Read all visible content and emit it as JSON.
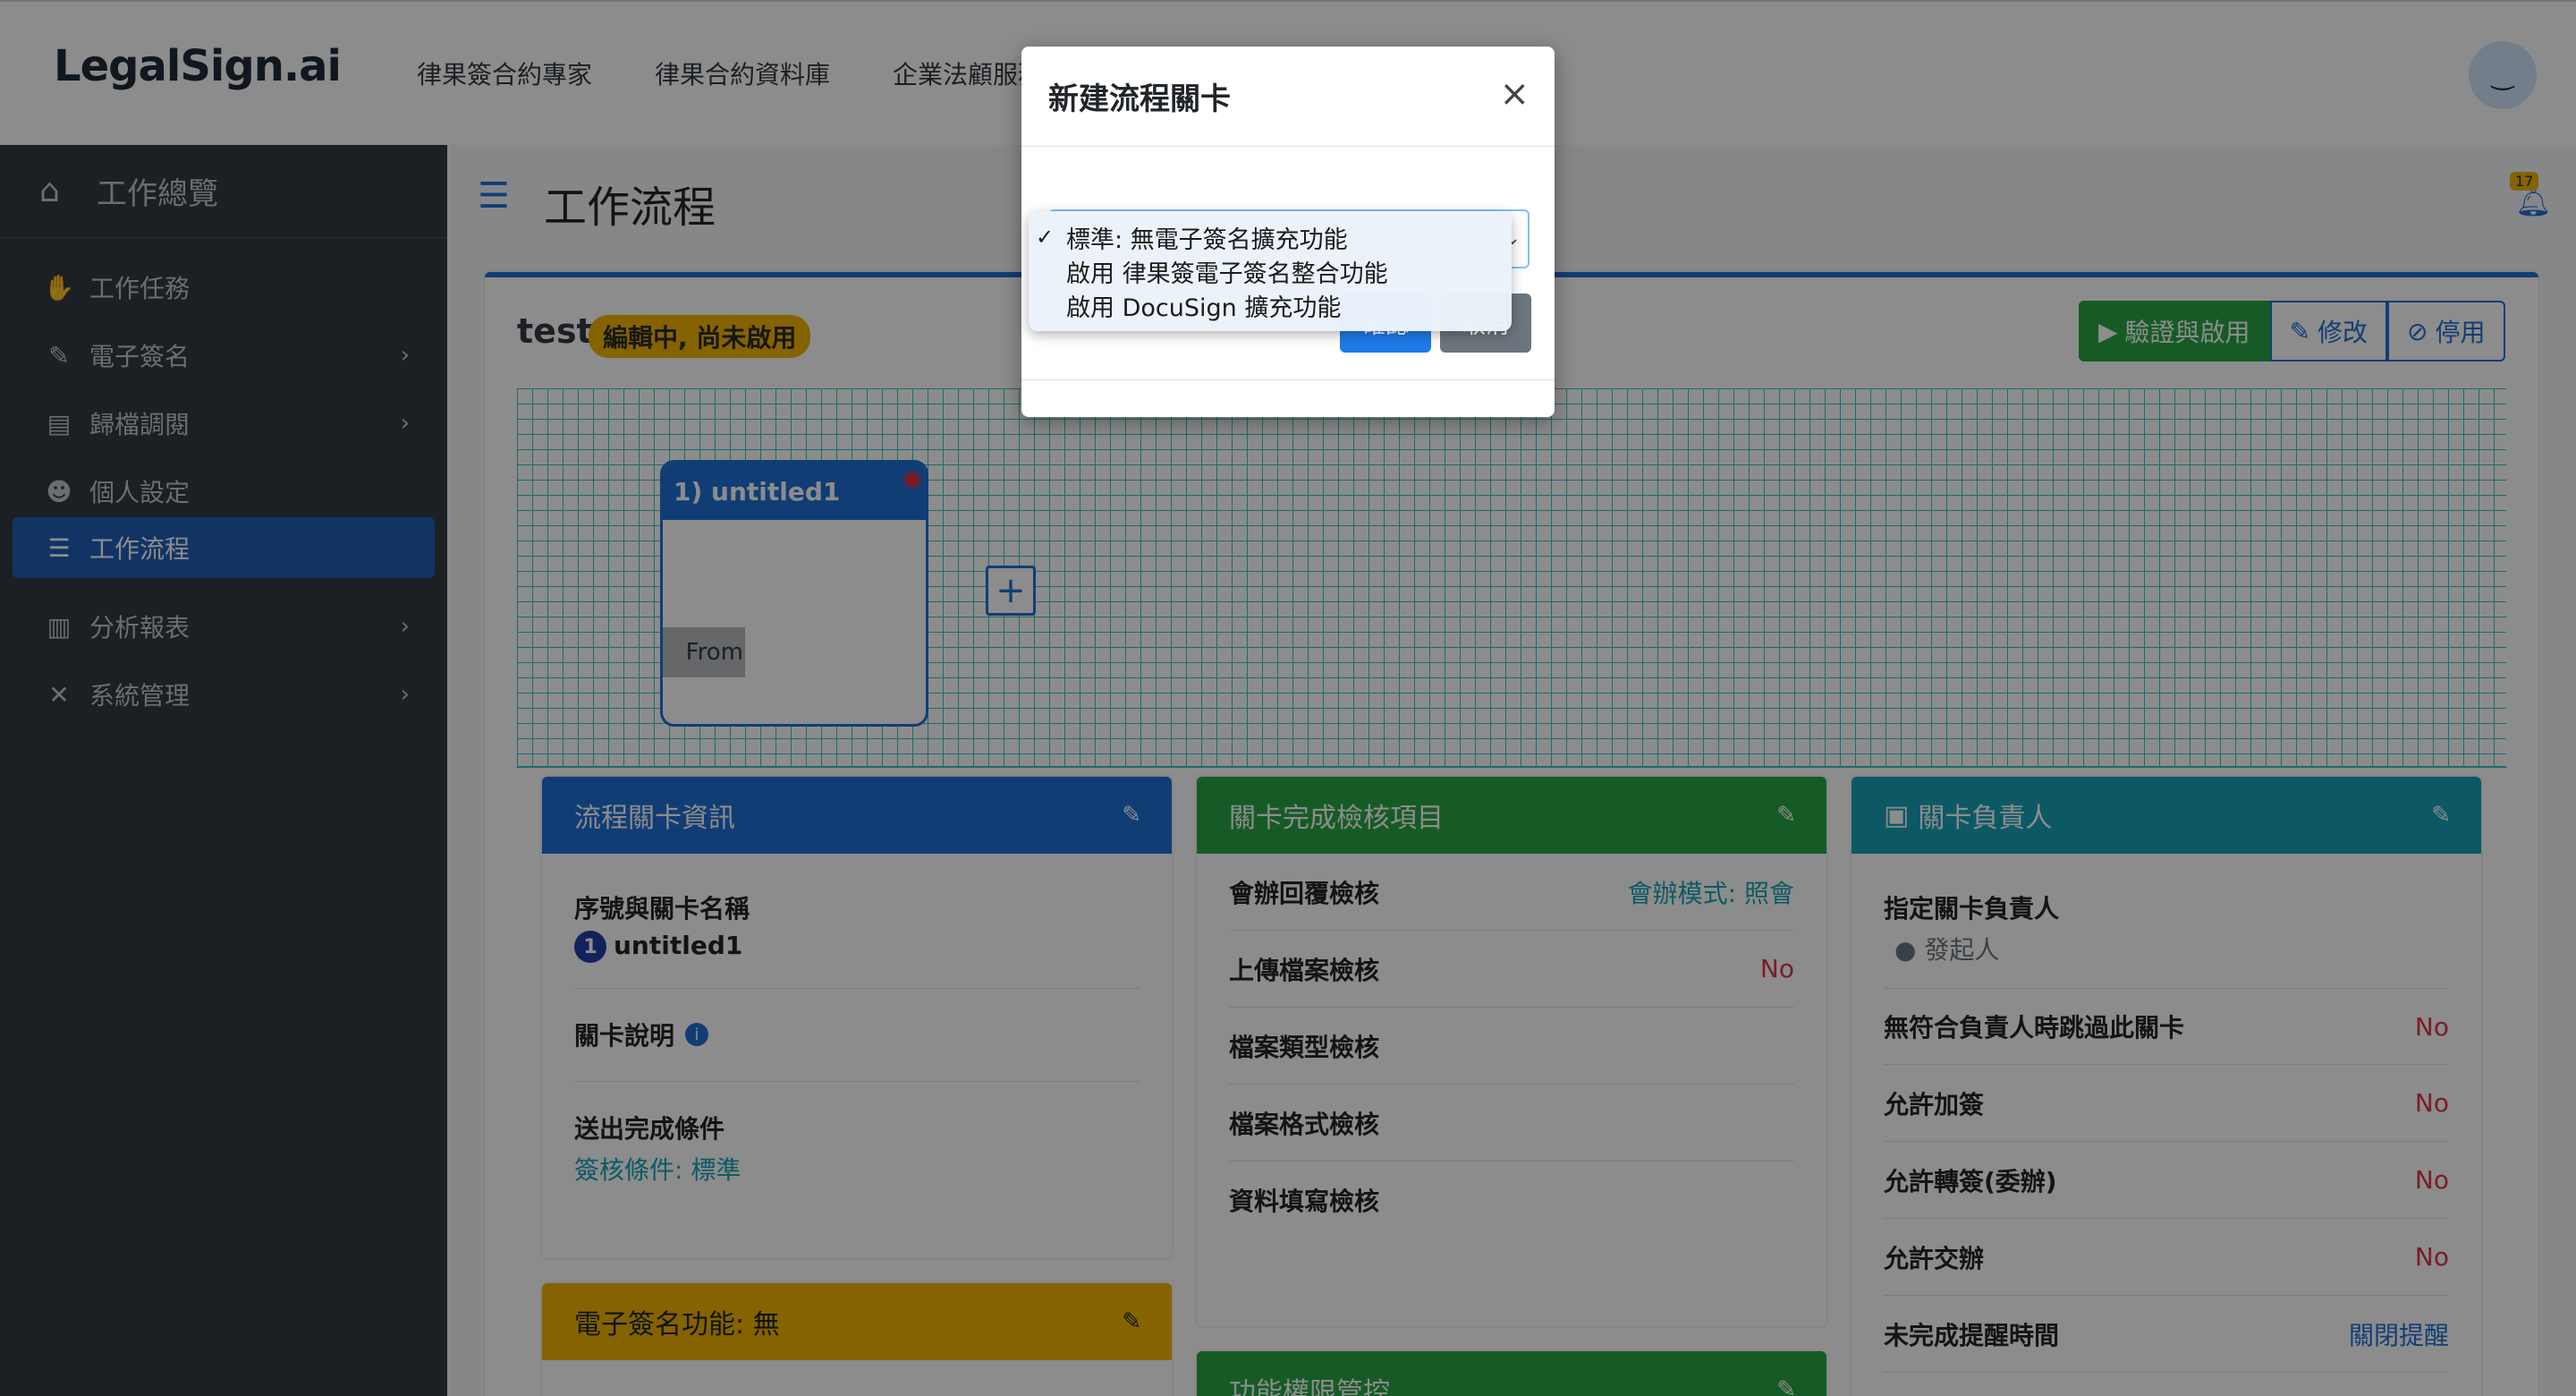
{
  "topbar": {
    "logo": "LegalSign.ai",
    "nav": [
      "律果簽合約專家",
      "律果合約資料庫",
      "企業法顧服務"
    ],
    "avatar_icon": "smile-face-icon"
  },
  "sidebar": {
    "header": "工作總覽",
    "items": [
      {
        "label": "工作任務",
        "icon": "handshake-icon",
        "has_chevron": false
      },
      {
        "label": "電子簽名",
        "icon": "signature-icon",
        "has_chevron": true
      },
      {
        "label": "歸檔調閱",
        "icon": "archive-icon",
        "has_chevron": true
      },
      {
        "label": "個人設定",
        "icon": "user-cog-icon",
        "has_chevron": false
      },
      {
        "label": "工作流程",
        "icon": "tasks-icon",
        "has_chevron": false,
        "active": true
      },
      {
        "label": "分析報表",
        "icon": "chart-icon",
        "has_chevron": true
      },
      {
        "label": "系統管理",
        "icon": "tools-icon",
        "has_chevron": true
      }
    ]
  },
  "page": {
    "title": "工作流程",
    "notification_count": "17"
  },
  "flow": {
    "name": "test",
    "status": "編輯中, 尚未啟用",
    "buttons": {
      "validate": "驗證與啟用",
      "edit": "修改",
      "disable": "停用"
    },
    "node": {
      "title": "1) untitled1",
      "from_label": "From"
    }
  },
  "panels": {
    "stage_info": {
      "title": "流程關卡資訊",
      "seq_label": "序號與關卡名稱",
      "seq_num": "1",
      "seq_name": "untitled1",
      "desc_label": "關卡說明",
      "cond_label": "送出完成條件",
      "cond_value": "簽核條件: 標準"
    },
    "checks": {
      "title": "關卡完成檢核項目",
      "rows": [
        {
          "label": "會辦回覆檢核",
          "value": "會辦模式: 照會"
        },
        {
          "label": "上傳檔案檢核",
          "value": "No"
        },
        {
          "label": "檔案類型檢核",
          "value": ""
        },
        {
          "label": "檔案格式檢核",
          "value": ""
        },
        {
          "label": "資料填寫檢核",
          "value": ""
        }
      ]
    },
    "owner": {
      "title": "關卡負責人",
      "assign_label": "指定關卡負責人",
      "assign_value": "發起人",
      "rows": [
        {
          "label": "無符合負責人時跳過此關卡",
          "value": "No"
        },
        {
          "label": "允許加簽",
          "value": "No"
        },
        {
          "label": "允許轉簽(委辦)",
          "value": "No"
        },
        {
          "label": "允許交辦",
          "value": "No"
        },
        {
          "label": "未完成提醒時間",
          "value": "關閉提醒"
        }
      ]
    },
    "esign": {
      "title": "電子簽名功能: 無"
    },
    "permission": {
      "title": "功能權限管控"
    }
  },
  "modal": {
    "title": "新建流程關卡",
    "close": "×",
    "ok": "確認",
    "cancel": "取消",
    "options": [
      {
        "label": "標準: 無電子簽名擴充功能",
        "selected": true
      },
      {
        "label": "啟用 律果簽電子簽名整合功能",
        "selected": false
      },
      {
        "label": "啟用 DocuSign 擴充功能",
        "selected": false
      }
    ],
    "check_mark": "✓"
  },
  "colors": {
    "primary": "#1f6fd6",
    "success": "#28a745",
    "info": "#17a2b8",
    "warning": "#f0b400",
    "danger": "#dc3545",
    "sidebar": "#343a40"
  }
}
